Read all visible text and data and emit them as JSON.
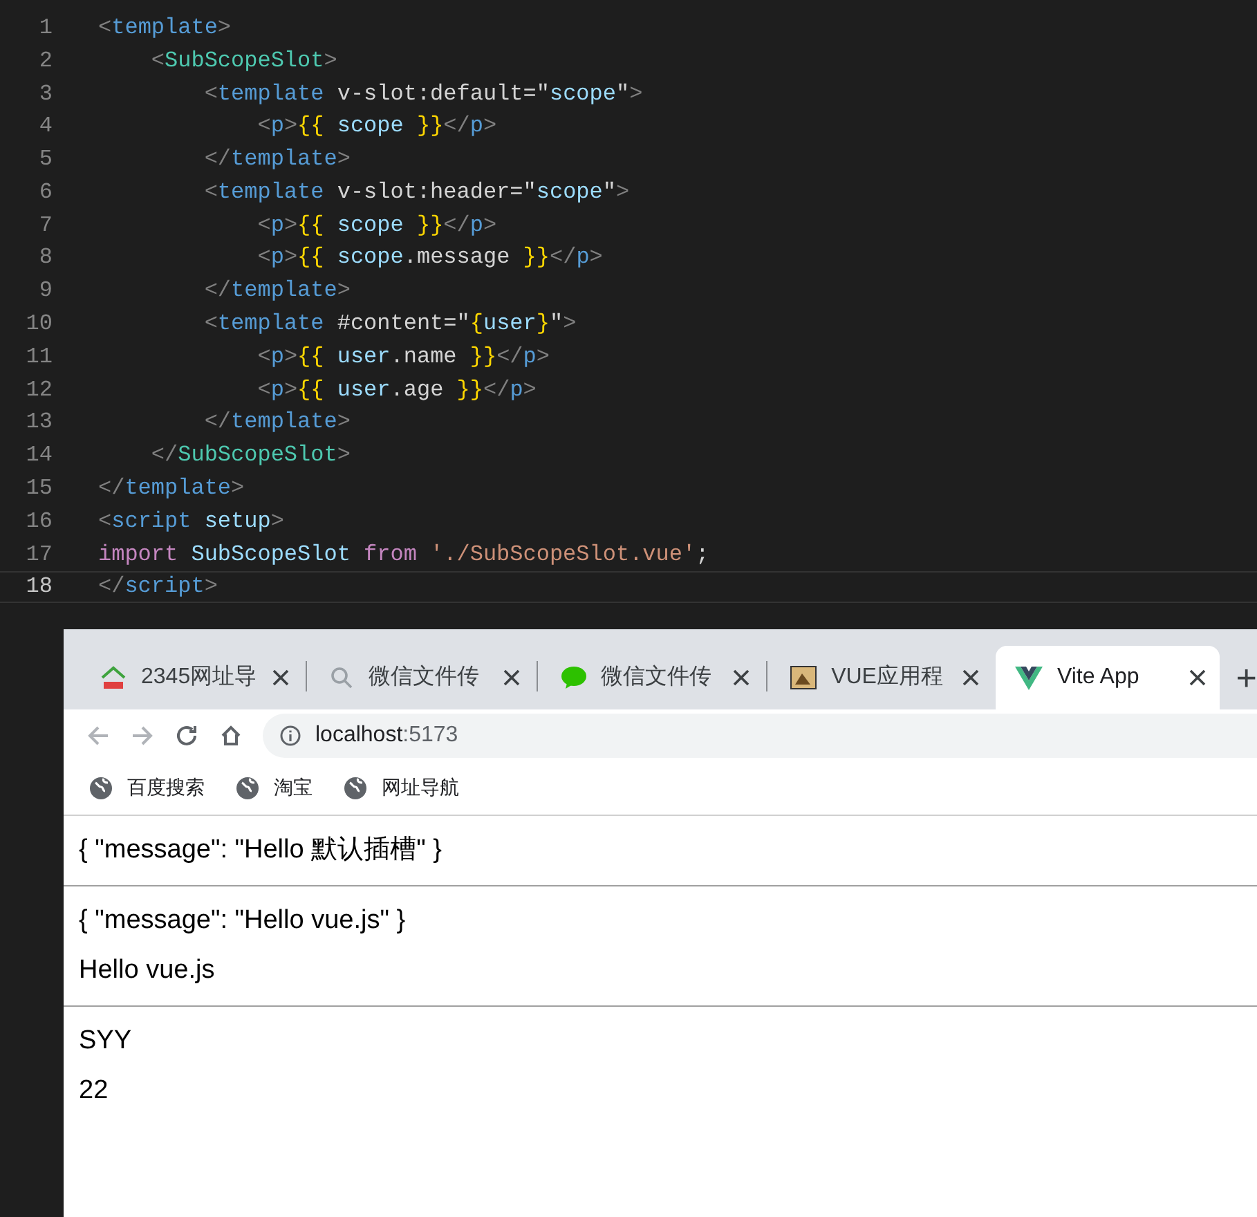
{
  "editor": {
    "lines": [
      {
        "number": "1",
        "current": false,
        "tokens": [
          {
            "kind": "punct",
            "text": "<"
          },
          {
            "kind": "tag",
            "text": "template"
          },
          {
            "kind": "punct",
            "text": ">"
          }
        ]
      },
      {
        "number": "2",
        "current": false,
        "tokens": [
          {
            "kind": "punct",
            "text": "    <"
          },
          {
            "kind": "component",
            "text": "SubScopeSlot"
          },
          {
            "kind": "punct",
            "text": ">"
          }
        ]
      },
      {
        "number": "3",
        "current": false,
        "tokens": [
          {
            "kind": "punct",
            "text": "        <"
          },
          {
            "kind": "tag",
            "text": "template"
          },
          {
            "kind": "plain",
            "text": " v-slot:default=\""
          },
          {
            "kind": "var",
            "text": "scope"
          },
          {
            "kind": "plain",
            "text": "\""
          },
          {
            "kind": "punct",
            "text": ">"
          }
        ]
      },
      {
        "number": "4",
        "current": false,
        "tokens": [
          {
            "kind": "punct",
            "text": "            <"
          },
          {
            "kind": "tag",
            "text": "p"
          },
          {
            "kind": "punct",
            "text": ">"
          },
          {
            "kind": "brace",
            "text": "{{"
          },
          {
            "kind": "var",
            "text": " scope "
          },
          {
            "kind": "brace",
            "text": "}}"
          },
          {
            "kind": "punct",
            "text": "</"
          },
          {
            "kind": "tag",
            "text": "p"
          },
          {
            "kind": "punct",
            "text": ">"
          }
        ]
      },
      {
        "number": "5",
        "current": false,
        "tokens": [
          {
            "kind": "punct",
            "text": "        </"
          },
          {
            "kind": "tag",
            "text": "template"
          },
          {
            "kind": "punct",
            "text": ">"
          }
        ]
      },
      {
        "number": "6",
        "current": false,
        "tokens": [
          {
            "kind": "punct",
            "text": "        <"
          },
          {
            "kind": "tag",
            "text": "template"
          },
          {
            "kind": "plain",
            "text": " v-slot:header=\""
          },
          {
            "kind": "var",
            "text": "scope"
          },
          {
            "kind": "plain",
            "text": "\""
          },
          {
            "kind": "punct",
            "text": ">"
          }
        ]
      },
      {
        "number": "7",
        "current": false,
        "tokens": [
          {
            "kind": "punct",
            "text": "            <"
          },
          {
            "kind": "tag",
            "text": "p"
          },
          {
            "kind": "punct",
            "text": ">"
          },
          {
            "kind": "brace",
            "text": "{{"
          },
          {
            "kind": "var",
            "text": " scope "
          },
          {
            "kind": "brace",
            "text": "}}"
          },
          {
            "kind": "punct",
            "text": "</"
          },
          {
            "kind": "tag",
            "text": "p"
          },
          {
            "kind": "punct",
            "text": ">"
          }
        ]
      },
      {
        "number": "8",
        "current": false,
        "tokens": [
          {
            "kind": "punct",
            "text": "            <"
          },
          {
            "kind": "tag",
            "text": "p"
          },
          {
            "kind": "punct",
            "text": ">"
          },
          {
            "kind": "brace",
            "text": "{{"
          },
          {
            "kind": "var",
            "text": " scope"
          },
          {
            "kind": "plain",
            "text": ".message "
          },
          {
            "kind": "brace",
            "text": "}}"
          },
          {
            "kind": "punct",
            "text": "</"
          },
          {
            "kind": "tag",
            "text": "p"
          },
          {
            "kind": "punct",
            "text": ">"
          }
        ]
      },
      {
        "number": "9",
        "current": false,
        "tokens": [
          {
            "kind": "punct",
            "text": "        </"
          },
          {
            "kind": "tag",
            "text": "template"
          },
          {
            "kind": "punct",
            "text": ">"
          }
        ]
      },
      {
        "number": "10",
        "current": false,
        "tokens": [
          {
            "kind": "punct",
            "text": "        <"
          },
          {
            "kind": "tag",
            "text": "template"
          },
          {
            "kind": "plain",
            "text": " #content=\""
          },
          {
            "kind": "brace",
            "text": "{"
          },
          {
            "kind": "var",
            "text": "user"
          },
          {
            "kind": "brace",
            "text": "}"
          },
          {
            "kind": "plain",
            "text": "\""
          },
          {
            "kind": "punct",
            "text": ">"
          }
        ]
      },
      {
        "number": "11",
        "current": false,
        "tokens": [
          {
            "kind": "punct",
            "text": "            <"
          },
          {
            "kind": "tag",
            "text": "p"
          },
          {
            "kind": "punct",
            "text": ">"
          },
          {
            "kind": "brace",
            "text": "{{"
          },
          {
            "kind": "var",
            "text": " user"
          },
          {
            "kind": "plain",
            "text": ".name "
          },
          {
            "kind": "brace",
            "text": "}}"
          },
          {
            "kind": "punct",
            "text": "</"
          },
          {
            "kind": "tag",
            "text": "p"
          },
          {
            "kind": "punct",
            "text": ">"
          }
        ]
      },
      {
        "number": "12",
        "current": false,
        "tokens": [
          {
            "kind": "punct",
            "text": "            <"
          },
          {
            "kind": "tag",
            "text": "p"
          },
          {
            "kind": "punct",
            "text": ">"
          },
          {
            "kind": "brace",
            "text": "{{"
          },
          {
            "kind": "var",
            "text": " user"
          },
          {
            "kind": "plain",
            "text": ".age "
          },
          {
            "kind": "brace",
            "text": "}}"
          },
          {
            "kind": "punct",
            "text": "</"
          },
          {
            "kind": "tag",
            "text": "p"
          },
          {
            "kind": "punct",
            "text": ">"
          }
        ]
      },
      {
        "number": "13",
        "current": false,
        "tokens": [
          {
            "kind": "punct",
            "text": "        </"
          },
          {
            "kind": "tag",
            "text": "template"
          },
          {
            "kind": "punct",
            "text": ">"
          }
        ]
      },
      {
        "number": "14",
        "current": false,
        "tokens": [
          {
            "kind": "punct",
            "text": "    </"
          },
          {
            "kind": "component",
            "text": "SubScopeSlot"
          },
          {
            "kind": "punct",
            "text": ">"
          }
        ]
      },
      {
        "number": "15",
        "current": false,
        "tokens": [
          {
            "kind": "punct",
            "text": "</"
          },
          {
            "kind": "tag",
            "text": "template"
          },
          {
            "kind": "punct",
            "text": ">"
          }
        ]
      },
      {
        "number": "16",
        "current": false,
        "tokens": [
          {
            "kind": "punct",
            "text": "<"
          },
          {
            "kind": "tag",
            "text": "script"
          },
          {
            "kind": "var",
            "text": " setup"
          },
          {
            "kind": "punct",
            "text": ">"
          }
        ]
      },
      {
        "number": "17",
        "current": false,
        "tokens": [
          {
            "kind": "keyword",
            "text": "import"
          },
          {
            "kind": "var",
            "text": " SubScopeSlot "
          },
          {
            "kind": "keyword",
            "text": "from"
          },
          {
            "kind": "string",
            "text": " './SubScopeSlot.vue'"
          },
          {
            "kind": "plain",
            "text": ";"
          }
        ]
      },
      {
        "number": "18",
        "current": true,
        "tokens": [
          {
            "kind": "punct",
            "text": "</"
          },
          {
            "kind": "tag",
            "text": "script"
          },
          {
            "kind": "punct",
            "text": ">"
          }
        ]
      }
    ]
  },
  "browser": {
    "tabs": [
      {
        "title": "2345网址导",
        "selected": false
      },
      {
        "title": "微信文件传",
        "selected": false
      },
      {
        "title": "微信文件传",
        "selected": false
      },
      {
        "title": "VUE应用程",
        "selected": false
      },
      {
        "title": "Vite App",
        "selected": true
      }
    ],
    "new_tab": "+",
    "address": {
      "host": "localhost",
      "port": ":5173"
    },
    "bookmarks": [
      "百度搜索",
      "淘宝",
      "网址导航"
    ],
    "content": [
      {
        "kind": "text",
        "text": "{ \"message\": \"Hello 默认插槽\" }"
      },
      {
        "kind": "rule"
      },
      {
        "kind": "text",
        "text": "{ \"message\": \"Hello vue.js\" }"
      },
      {
        "kind": "text",
        "text": "Hello vue.js"
      },
      {
        "kind": "rule"
      },
      {
        "kind": "text",
        "text": "SYY"
      },
      {
        "kind": "text",
        "text": "22"
      }
    ]
  }
}
